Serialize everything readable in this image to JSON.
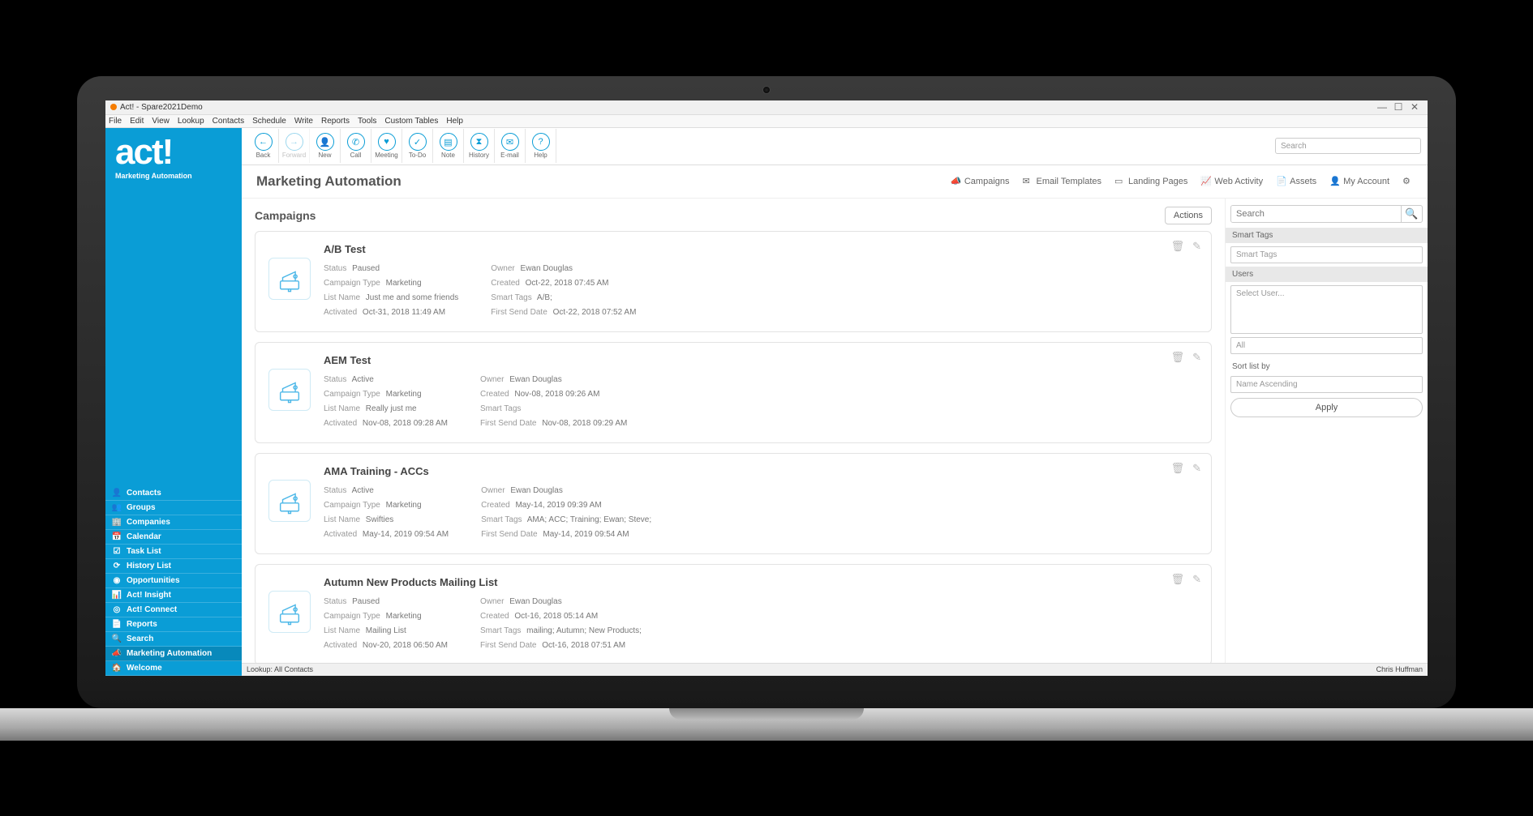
{
  "window": {
    "title": "Act! - Spare2021Demo"
  },
  "menubar": [
    "File",
    "Edit",
    "View",
    "Lookup",
    "Contacts",
    "Schedule",
    "Write",
    "Reports",
    "Tools",
    "Custom Tables",
    "Help"
  ],
  "toolbar": {
    "buttons": [
      {
        "label": "Back",
        "glyph": "←",
        "disabled": false
      },
      {
        "label": "Forward",
        "glyph": "→",
        "disabled": true
      },
      {
        "label": "New",
        "glyph": "👤",
        "disabled": false
      },
      {
        "label": "Call",
        "glyph": "✆",
        "disabled": false
      },
      {
        "label": "Meeting",
        "glyph": "♥",
        "disabled": false
      },
      {
        "label": "To-Do",
        "glyph": "✓",
        "disabled": false
      },
      {
        "label": "Note",
        "glyph": "▤",
        "disabled": false
      },
      {
        "label": "History",
        "glyph": "⧗",
        "disabled": false
      },
      {
        "label": "E-mail",
        "glyph": "✉",
        "disabled": false
      },
      {
        "label": "Help",
        "glyph": "?",
        "disabled": false
      }
    ],
    "search_placeholder": "Search"
  },
  "sidebar": {
    "logo": "act!",
    "subtitle": "Marketing Automation",
    "items": [
      {
        "icon": "👤",
        "label": "Contacts"
      },
      {
        "icon": "👥",
        "label": "Groups"
      },
      {
        "icon": "🏢",
        "label": "Companies"
      },
      {
        "icon": "📅",
        "label": "Calendar"
      },
      {
        "icon": "☑",
        "label": "Task List"
      },
      {
        "icon": "⟳",
        "label": "History List"
      },
      {
        "icon": "◉",
        "label": "Opportunities"
      },
      {
        "icon": "📊",
        "label": "Act! Insight"
      },
      {
        "icon": "◎",
        "label": "Act! Connect"
      },
      {
        "icon": "📄",
        "label": "Reports"
      },
      {
        "icon": "🔍",
        "label": "Search"
      },
      {
        "icon": "📣",
        "label": "Marketing Automation"
      },
      {
        "icon": "🏠",
        "label": "Welcome"
      }
    ]
  },
  "subheader": {
    "title": "Marketing Automation",
    "links": [
      {
        "label": "Campaigns"
      },
      {
        "label": "Email Templates"
      },
      {
        "label": "Landing Pages"
      },
      {
        "label": "Web Activity"
      },
      {
        "label": "Assets"
      },
      {
        "label": "My Account"
      }
    ]
  },
  "campaigns": {
    "heading": "Campaigns",
    "actions_label": "Actions",
    "cards": [
      {
        "title": "A/B Test",
        "left": [
          [
            "Status",
            "Paused"
          ],
          [
            "Campaign Type",
            "Marketing"
          ],
          [
            "List Name",
            "Just me and some friends"
          ],
          [
            "Activated",
            "Oct-31, 2018 11:49 AM"
          ]
        ],
        "right": [
          [
            "Owner",
            "Ewan Douglas"
          ],
          [
            "Created",
            "Oct-22, 2018 07:45 AM"
          ],
          [
            "Smart Tags",
            "A/B;"
          ],
          [
            "First Send Date",
            "Oct-22, 2018 07:52 AM"
          ]
        ]
      },
      {
        "title": "AEM Test",
        "left": [
          [
            "Status",
            "Active"
          ],
          [
            "Campaign Type",
            "Marketing"
          ],
          [
            "List Name",
            "Really just me"
          ],
          [
            "Activated",
            "Nov-08, 2018 09:28 AM"
          ]
        ],
        "right": [
          [
            "Owner",
            "Ewan Douglas"
          ],
          [
            "Created",
            "Nov-08, 2018 09:26 AM"
          ],
          [
            "Smart Tags",
            ""
          ],
          [
            "First Send Date",
            "Nov-08, 2018 09:29 AM"
          ]
        ]
      },
      {
        "title": "AMA Training - ACCs",
        "left": [
          [
            "Status",
            "Active"
          ],
          [
            "Campaign Type",
            "Marketing"
          ],
          [
            "List Name",
            "Swifties"
          ],
          [
            "Activated",
            "May-14, 2019 09:54 AM"
          ]
        ],
        "right": [
          [
            "Owner",
            "Ewan Douglas"
          ],
          [
            "Created",
            "May-14, 2019 09:39 AM"
          ],
          [
            "Smart Tags",
            "AMA; ACC; Training; Ewan; Steve;"
          ],
          [
            "First Send Date",
            "May-14, 2019 09:54 AM"
          ]
        ]
      },
      {
        "title": "Autumn New Products Mailing List",
        "left": [
          [
            "Status",
            "Paused"
          ],
          [
            "Campaign Type",
            "Marketing"
          ],
          [
            "List Name",
            "Mailing List"
          ],
          [
            "Activated",
            "Nov-20, 2018 06:50 AM"
          ]
        ],
        "right": [
          [
            "Owner",
            "Ewan Douglas"
          ],
          [
            "Created",
            "Oct-16, 2018 05:14 AM"
          ],
          [
            "Smart Tags",
            "mailing; Autumn; New Products;"
          ],
          [
            "First Send Date",
            "Oct-16, 2018 07:51 AM"
          ]
        ]
      }
    ]
  },
  "filters": {
    "search_placeholder": "Search",
    "smart_tags_header": "Smart Tags",
    "smart_tags_placeholder": "Smart Tags",
    "users_header": "Users",
    "users_placeholder": "Select User...",
    "all_label": "All",
    "sort_label": "Sort list by",
    "sort_value": "Name Ascending",
    "apply_label": "Apply"
  },
  "statusbar": {
    "left": "Lookup: All Contacts",
    "right": "Chris Huffman"
  }
}
